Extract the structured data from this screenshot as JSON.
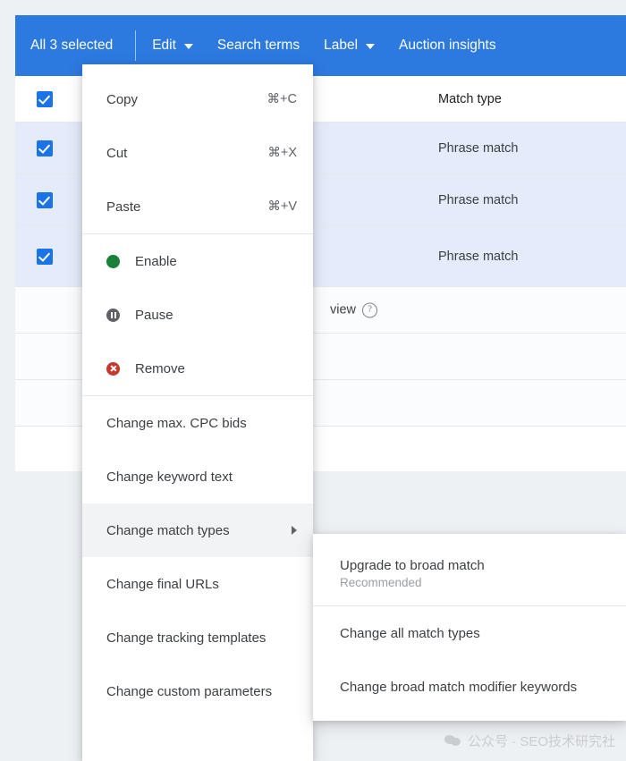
{
  "toolbar": {
    "selected_label": "All 3 selected",
    "items": [
      {
        "label": "Edit",
        "has_caret": true
      },
      {
        "label": "Search terms",
        "has_caret": false
      },
      {
        "label": "Label",
        "has_caret": true
      },
      {
        "label": "Auction insights",
        "has_caret": false
      }
    ],
    "background_color": "#2c79e0"
  },
  "table": {
    "match_type_header": "Match type",
    "view_cell_text": "view",
    "rows": [
      {
        "checked": true,
        "status": "gray",
        "match_type": "Match type"
      },
      {
        "checked": true,
        "status": "green",
        "match_type": "Phrase match"
      },
      {
        "checked": true,
        "status": "green",
        "match_type": "Phrase match"
      },
      {
        "checked": true,
        "status": "green",
        "match_type": "Phrase match"
      }
    ],
    "selected_row_color": "#e4ebfa"
  },
  "context_menu": {
    "groups": [
      {
        "items": [
          {
            "label": "Copy",
            "accel": "⌘+C"
          },
          {
            "label": "Cut",
            "accel": "⌘+X"
          },
          {
            "label": "Paste",
            "accel": "⌘+V"
          }
        ]
      },
      {
        "items": [
          {
            "label": "Enable",
            "icon": "status-enabled-icon",
            "icon_color": "#188038"
          },
          {
            "label": "Pause",
            "icon": "status-paused-icon",
            "icon_color": "#5f6368"
          },
          {
            "label": "Remove",
            "icon": "status-removed-icon",
            "icon_color": "#c5382b"
          }
        ]
      },
      {
        "items": [
          {
            "label": "Change max. CPC bids"
          },
          {
            "label": "Change keyword text"
          },
          {
            "label": "Change match types",
            "submenu": true,
            "highlighted": true
          },
          {
            "label": "Change final URLs"
          },
          {
            "label": "Change tracking templates"
          },
          {
            "label": "Change custom parameters"
          }
        ]
      }
    ]
  },
  "sub_menu": {
    "items": [
      {
        "label": "Upgrade to broad match",
        "sublabel": "Recommended"
      },
      {
        "label": "Change all match types"
      },
      {
        "label": "Change broad match modifier keywords"
      }
    ]
  },
  "watermark": {
    "text": "公众号 · SEO技术研究社",
    "icon": "wechat-icon"
  }
}
